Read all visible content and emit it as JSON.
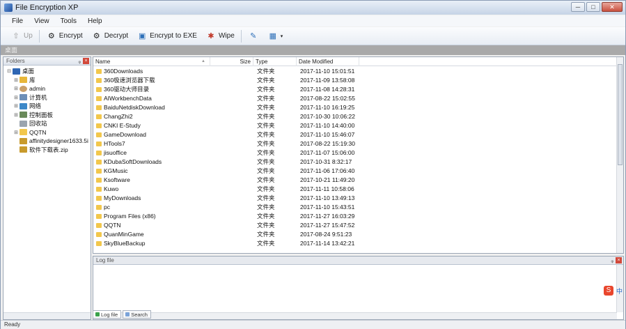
{
  "window": {
    "title": "File Encryption XP"
  },
  "menu": [
    "File",
    "View",
    "Tools",
    "Help"
  ],
  "toolbar": {
    "up_label": "Up",
    "encrypt_label": "Encrypt",
    "decrypt_label": "Decrypt",
    "encrypt_exe_label": "Encrypt to EXE",
    "wipe_label": "Wipe"
  },
  "path": "桌面",
  "folders_panel": {
    "title": "Folders",
    "pin": "ᵩ",
    "close": "×"
  },
  "tree": [
    {
      "label": "桌面",
      "icon": "desktop-icon",
      "toggle": "⊟",
      "indent": 0
    },
    {
      "label": "库",
      "icon": "library-icon",
      "toggle": "⊞",
      "indent": 1
    },
    {
      "label": "admin",
      "icon": "user-icon",
      "toggle": "⊞",
      "indent": 1
    },
    {
      "label": "计算机",
      "icon": "computer-icon",
      "toggle": "⊞",
      "indent": 1
    },
    {
      "label": "网络",
      "icon": "network-icon",
      "toggle": "⊞",
      "indent": 1
    },
    {
      "label": "控制面板",
      "icon": "control-panel-icon",
      "toggle": "⊞",
      "indent": 1
    },
    {
      "label": "回收站",
      "icon": "recycle-bin-icon",
      "toggle": "",
      "indent": 1
    },
    {
      "label": "QQTN",
      "icon": "folder-icon",
      "toggle": "⊞",
      "indent": 1
    },
    {
      "label": "affinitydesigner1633.5i",
      "icon": "file-icon",
      "toggle": "",
      "indent": 1
    },
    {
      "label": "软件下载表.zip",
      "icon": "zip-icon",
      "toggle": "",
      "indent": 1
    }
  ],
  "file_list": {
    "columns": {
      "name": "Name",
      "size": "Size",
      "type": "Type",
      "modified": "Date Modified"
    },
    "rows": [
      {
        "name": "360Downloads",
        "type": "文件夹",
        "modified": "2017-11-10 15:01:51"
      },
      {
        "name": "360极速浏览器下载",
        "type": "文件夹",
        "modified": "2017-11-09 13:58:08"
      },
      {
        "name": "360驱动大师目录",
        "type": "文件夹",
        "modified": "2017-11-08 14:28:31"
      },
      {
        "name": "AIWorkbenchData",
        "type": "文件夹",
        "modified": "2017-08-22 15:02:55"
      },
      {
        "name": "BaiduNetdiskDownload",
        "type": "文件夹",
        "modified": "2017-11-10 16:19:25"
      },
      {
        "name": "ChangZhi2",
        "type": "文件夹",
        "modified": "2017-10-30 10:06:22"
      },
      {
        "name": "CNKI E-Study",
        "type": "文件夹",
        "modified": "2017-11-10 14:40:00"
      },
      {
        "name": "GameDownload",
        "type": "文件夹",
        "modified": "2017-11-10 15:46:07"
      },
      {
        "name": "HTools7",
        "type": "文件夹",
        "modified": "2017-08-22 15:19:30"
      },
      {
        "name": "jisuoffice",
        "type": "文件夹",
        "modified": "2017-11-07 15:06:00"
      },
      {
        "name": "KDubaSoftDownloads",
        "type": "文件夹",
        "modified": "2017-10-31 8:32:17"
      },
      {
        "name": "KGMusic",
        "type": "文件夹",
        "modified": "2017-11-06 17:06:40"
      },
      {
        "name": "Ksoftware",
        "type": "文件夹",
        "modified": "2017-10-21 11:49:20"
      },
      {
        "name": "Kuwo",
        "type": "文件夹",
        "modified": "2017-11-11 10:58:06"
      },
      {
        "name": "MyDownloads",
        "type": "文件夹",
        "modified": "2017-11-10 13:49:13"
      },
      {
        "name": "pc",
        "type": "文件夹",
        "modified": "2017-11-10 15:43:51"
      },
      {
        "name": "Program Files (x86)",
        "type": "文件夹",
        "modified": "2017-11-27 16:03:29"
      },
      {
        "name": "QQTN",
        "type": "文件夹",
        "modified": "2017-11-27 15:47:52"
      },
      {
        "name": "QuanMinGame",
        "type": "文件夹",
        "modified": "2017-08-24 9:51:23"
      },
      {
        "name": "SkyBlueBackup",
        "type": "文件夹",
        "modified": "2017-11-14 13:42:21"
      }
    ]
  },
  "log_panel": {
    "title": "Log file",
    "pin": "ᵩ",
    "close": "×"
  },
  "tabs": [
    {
      "label": "Log file",
      "icon": "log-icon"
    },
    {
      "label": "Search",
      "icon": "search-icon"
    }
  ],
  "ime": {
    "badge": "S",
    "lang": "中"
  },
  "status": "Ready"
}
